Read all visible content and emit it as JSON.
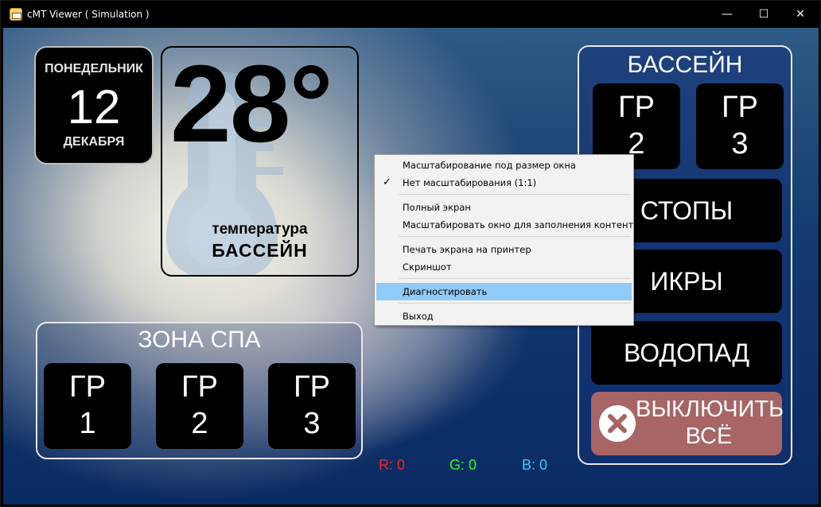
{
  "window": {
    "title": "cMT Viewer ( Simulation )",
    "controls": {
      "minimize": "—",
      "maximize": "☐",
      "close": "✕"
    }
  },
  "date": {
    "weekday": "ПОНЕДЕЛЬНИК",
    "day": "12",
    "month": "ДЕКАБРЯ"
  },
  "temperature": {
    "value": "28°",
    "label": "температура",
    "sublabel": "БАССЕЙН"
  },
  "spa_zone": {
    "title": "ЗОНА СПА",
    "buttons": [
      {
        "line1": "ГР",
        "line2": "1"
      },
      {
        "line1": "ГР",
        "line2": "2"
      },
      {
        "line1": "ГР",
        "line2": "3"
      }
    ]
  },
  "pool": {
    "title": "БАССЕЙН",
    "gr_buttons": [
      {
        "line1": "ГР",
        "line2": "2"
      },
      {
        "line1": "ГР",
        "line2": "3"
      }
    ],
    "buttons": [
      "СТОПЫ",
      "ИКРЫ",
      "ВОДОПАД"
    ],
    "off_button": {
      "line1": "ВЫКЛЮЧИТЬ",
      "line2": "ВСЁ"
    }
  },
  "rgb": {
    "r": "R: 0",
    "g": "G: 0",
    "b": "B: 0"
  },
  "context_menu": {
    "items": [
      {
        "label": "Масштабирование под размер окна",
        "checked": false
      },
      {
        "label": "Нет масштабирования (1:1)",
        "checked": true
      },
      {
        "label": "Полный экран",
        "checked": false
      },
      {
        "label": "Масштабировать окно для заполнения контента",
        "checked": false
      },
      {
        "label": "Печать экрана на принтер",
        "checked": false
      },
      {
        "label": "Скриншот",
        "checked": false
      },
      {
        "label": "Диагностировать",
        "checked": false,
        "highlighted": true
      },
      {
        "label": "Выход",
        "checked": false
      }
    ],
    "check_glyph": "✓"
  },
  "colors": {
    "off_button": "#a86565",
    "menu_highlight": "#91c9f7",
    "r_text": "#ff2020",
    "g_text": "#22ff22",
    "b_text": "#33ccff"
  },
  "icons": {
    "app": "app-icon",
    "thermometer": "thermometer-icon",
    "off": "close-circle-icon"
  }
}
